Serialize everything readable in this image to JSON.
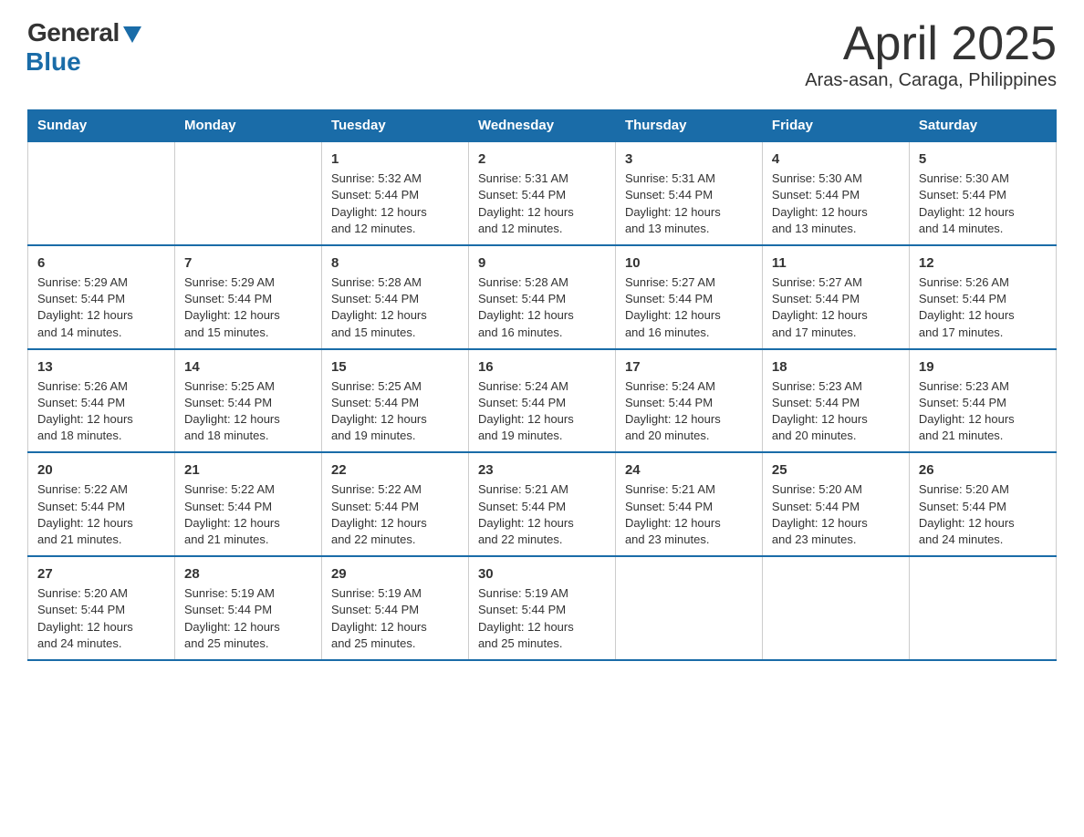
{
  "logo": {
    "general": "General",
    "blue": "Blue"
  },
  "title": {
    "month": "April 2025",
    "location": "Aras-asan, Caraga, Philippines"
  },
  "header_days": [
    "Sunday",
    "Monday",
    "Tuesday",
    "Wednesday",
    "Thursday",
    "Friday",
    "Saturday"
  ],
  "weeks": [
    [
      {
        "day": "",
        "info": ""
      },
      {
        "day": "",
        "info": ""
      },
      {
        "day": "1",
        "info": "Sunrise: 5:32 AM\nSunset: 5:44 PM\nDaylight: 12 hours\nand 12 minutes."
      },
      {
        "day": "2",
        "info": "Sunrise: 5:31 AM\nSunset: 5:44 PM\nDaylight: 12 hours\nand 12 minutes."
      },
      {
        "day": "3",
        "info": "Sunrise: 5:31 AM\nSunset: 5:44 PM\nDaylight: 12 hours\nand 13 minutes."
      },
      {
        "day": "4",
        "info": "Sunrise: 5:30 AM\nSunset: 5:44 PM\nDaylight: 12 hours\nand 13 minutes."
      },
      {
        "day": "5",
        "info": "Sunrise: 5:30 AM\nSunset: 5:44 PM\nDaylight: 12 hours\nand 14 minutes."
      }
    ],
    [
      {
        "day": "6",
        "info": "Sunrise: 5:29 AM\nSunset: 5:44 PM\nDaylight: 12 hours\nand 14 minutes."
      },
      {
        "day": "7",
        "info": "Sunrise: 5:29 AM\nSunset: 5:44 PM\nDaylight: 12 hours\nand 15 minutes."
      },
      {
        "day": "8",
        "info": "Sunrise: 5:28 AM\nSunset: 5:44 PM\nDaylight: 12 hours\nand 15 minutes."
      },
      {
        "day": "9",
        "info": "Sunrise: 5:28 AM\nSunset: 5:44 PM\nDaylight: 12 hours\nand 16 minutes."
      },
      {
        "day": "10",
        "info": "Sunrise: 5:27 AM\nSunset: 5:44 PM\nDaylight: 12 hours\nand 16 minutes."
      },
      {
        "day": "11",
        "info": "Sunrise: 5:27 AM\nSunset: 5:44 PM\nDaylight: 12 hours\nand 17 minutes."
      },
      {
        "day": "12",
        "info": "Sunrise: 5:26 AM\nSunset: 5:44 PM\nDaylight: 12 hours\nand 17 minutes."
      }
    ],
    [
      {
        "day": "13",
        "info": "Sunrise: 5:26 AM\nSunset: 5:44 PM\nDaylight: 12 hours\nand 18 minutes."
      },
      {
        "day": "14",
        "info": "Sunrise: 5:25 AM\nSunset: 5:44 PM\nDaylight: 12 hours\nand 18 minutes."
      },
      {
        "day": "15",
        "info": "Sunrise: 5:25 AM\nSunset: 5:44 PM\nDaylight: 12 hours\nand 19 minutes."
      },
      {
        "day": "16",
        "info": "Sunrise: 5:24 AM\nSunset: 5:44 PM\nDaylight: 12 hours\nand 19 minutes."
      },
      {
        "day": "17",
        "info": "Sunrise: 5:24 AM\nSunset: 5:44 PM\nDaylight: 12 hours\nand 20 minutes."
      },
      {
        "day": "18",
        "info": "Sunrise: 5:23 AM\nSunset: 5:44 PM\nDaylight: 12 hours\nand 20 minutes."
      },
      {
        "day": "19",
        "info": "Sunrise: 5:23 AM\nSunset: 5:44 PM\nDaylight: 12 hours\nand 21 minutes."
      }
    ],
    [
      {
        "day": "20",
        "info": "Sunrise: 5:22 AM\nSunset: 5:44 PM\nDaylight: 12 hours\nand 21 minutes."
      },
      {
        "day": "21",
        "info": "Sunrise: 5:22 AM\nSunset: 5:44 PM\nDaylight: 12 hours\nand 21 minutes."
      },
      {
        "day": "22",
        "info": "Sunrise: 5:22 AM\nSunset: 5:44 PM\nDaylight: 12 hours\nand 22 minutes."
      },
      {
        "day": "23",
        "info": "Sunrise: 5:21 AM\nSunset: 5:44 PM\nDaylight: 12 hours\nand 22 minutes."
      },
      {
        "day": "24",
        "info": "Sunrise: 5:21 AM\nSunset: 5:44 PM\nDaylight: 12 hours\nand 23 minutes."
      },
      {
        "day": "25",
        "info": "Sunrise: 5:20 AM\nSunset: 5:44 PM\nDaylight: 12 hours\nand 23 minutes."
      },
      {
        "day": "26",
        "info": "Sunrise: 5:20 AM\nSunset: 5:44 PM\nDaylight: 12 hours\nand 24 minutes."
      }
    ],
    [
      {
        "day": "27",
        "info": "Sunrise: 5:20 AM\nSunset: 5:44 PM\nDaylight: 12 hours\nand 24 minutes."
      },
      {
        "day": "28",
        "info": "Sunrise: 5:19 AM\nSunset: 5:44 PM\nDaylight: 12 hours\nand 25 minutes."
      },
      {
        "day": "29",
        "info": "Sunrise: 5:19 AM\nSunset: 5:44 PM\nDaylight: 12 hours\nand 25 minutes."
      },
      {
        "day": "30",
        "info": "Sunrise: 5:19 AM\nSunset: 5:44 PM\nDaylight: 12 hours\nand 25 minutes."
      },
      {
        "day": "",
        "info": ""
      },
      {
        "day": "",
        "info": ""
      },
      {
        "day": "",
        "info": ""
      }
    ]
  ]
}
